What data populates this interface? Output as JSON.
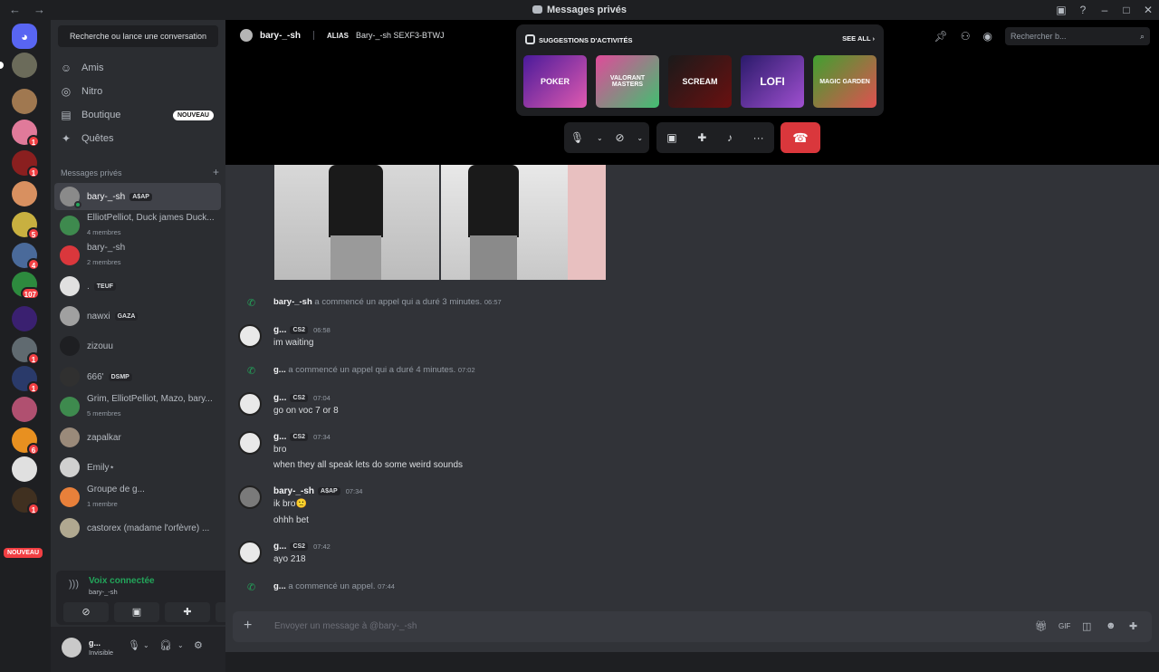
{
  "window": {
    "title": "Messages privés",
    "back": "←",
    "forward": "→"
  },
  "sidebar": {
    "search_label": "Recherche ou lance une conversation",
    "nav": [
      {
        "label": "Amis",
        "icon": "friends-icon"
      },
      {
        "label": "Nitro",
        "icon": "nitro-icon"
      },
      {
        "label": "Boutique",
        "icon": "shop-icon",
        "badge": "NOUVEAU"
      },
      {
        "label": "Quêtes",
        "icon": "quests-icon"
      }
    ],
    "dm_header": "Messages privés",
    "dms": [
      {
        "name": "bary-_-sh",
        "tag": "A$AP",
        "sub": ""
      },
      {
        "name": "ElliotPelliot, Duck james Duck...",
        "tag": "",
        "sub": "4 membres"
      },
      {
        "name": "bary-_-sh",
        "tag": "",
        "sub": "2 membres"
      },
      {
        "name": ".",
        "tag": "TEUF",
        "sub": ""
      },
      {
        "name": "nawxi",
        "tag": "GAZA",
        "sub": ""
      },
      {
        "name": "zizouu",
        "tag": "",
        "sub": ""
      },
      {
        "name": "666'",
        "tag": "DSMP",
        "sub": ""
      },
      {
        "name": "Grim, ElliotPelliot, Mazo, bary...",
        "tag": "",
        "sub": "5 membres"
      },
      {
        "name": "zapalkar",
        "tag": "",
        "sub": ""
      },
      {
        "name": "Emily⋆",
        "tag": "",
        "sub": ""
      },
      {
        "name": "Groupe de g...",
        "tag": "",
        "sub": "1 membre"
      },
      {
        "name": "castorex (madame l'orfèvre) ...",
        "tag": "",
        "sub": ""
      }
    ],
    "voice": {
      "title": "Voix connectée",
      "sub": "bary-_-sh"
    },
    "user": {
      "name": "g...",
      "status": "Invisible"
    }
  },
  "guilds": {
    "badges": [
      "1",
      "1",
      "1",
      "5",
      "4",
      "107",
      "1",
      "1",
      "6",
      "1"
    ],
    "new_label": "NOUVEAU"
  },
  "call": {
    "user": "bary-_-sh",
    "alias_label": "ALIAS",
    "alias_value": "Bary-_-sh SEXF3-BTWJ",
    "activities_title": "SUGGESTIONS D'ACTIVITÉS",
    "see_all": "SEE ALL",
    "activities": [
      "POKER",
      "VALORANT MASTERS",
      "SCREAM",
      "LOFI",
      "MAGIC GARDEN"
    ],
    "search_placeholder": "Rechercher b..."
  },
  "messages": {
    "sys1": {
      "author": "bary-_-sh",
      "text": " a commencé un appel qui a duré 3 minutes.",
      "time": "06:57"
    },
    "m1": {
      "author": "g...",
      "tag": "CS2",
      "time": "06:58",
      "lines": [
        "im waiting"
      ]
    },
    "sys2": {
      "author": "g...",
      "text": " a commencé un appel qui a duré 4 minutes.",
      "time": "07:02"
    },
    "m2": {
      "author": "g...",
      "tag": "CS2",
      "time": "07:04",
      "lines": [
        "go on voc 7 or 8"
      ]
    },
    "m3": {
      "author": "g...",
      "tag": "CS2",
      "time": "07:34",
      "lines": [
        "bro",
        "when they all speak lets do some weird sounds"
      ]
    },
    "m4": {
      "author": "bary-_-sh",
      "tag": "A$AP",
      "time": "07:34",
      "lines": [
        "ik bro🙁",
        "ohhh bet"
      ]
    },
    "m5": {
      "author": "g...",
      "tag": "CS2",
      "time": "07:42",
      "lines": [
        "ayo 218"
      ]
    },
    "sys3": {
      "author": "g...",
      "text": " a commencé un appel.",
      "time": "07:44"
    }
  },
  "composer": {
    "placeholder": "Envoyer un message à @bary-_-sh"
  }
}
